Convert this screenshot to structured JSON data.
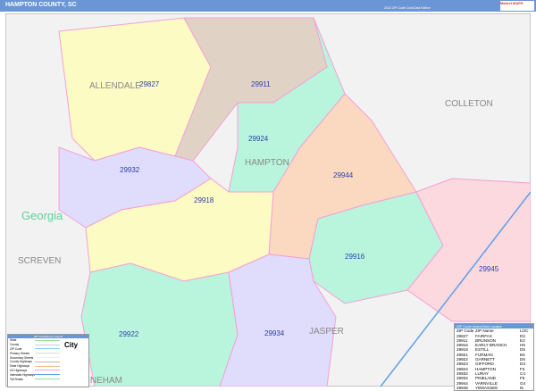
{
  "header": {
    "title": "HAMPTON COUNTY, SC",
    "edition": "2022 ZIP Code ColorCast Edition",
    "logo": "Market MAPS"
  },
  "areas": [
    "ALLENDALE",
    "COLLETON",
    "HAMPTON",
    "Georgia",
    "SCREVEN",
    "JASPER",
    "FINEHAM"
  ],
  "zips": [
    {
      "code": "29827",
      "color": "#fdfbc4"
    },
    {
      "code": "29911",
      "color": "#e0d3c5"
    },
    {
      "code": "29924",
      "color": "#b9f5dd"
    },
    {
      "code": "29944",
      "color": "#fbd9c1"
    },
    {
      "code": "29932",
      "color": "#e0dcfb"
    },
    {
      "code": "29918",
      "color": "#fdfbc4"
    },
    {
      "code": "29916",
      "color": "#b9f5dd"
    },
    {
      "code": "29945",
      "color": "#fcd8df"
    },
    {
      "code": "29922",
      "color": "#b9f5dd"
    },
    {
      "code": "29934",
      "color": "#e0dcfb"
    }
  ],
  "zip_table": {
    "title": "ZIP Code Index/Grid Locator",
    "headers": [
      "ZIP Code",
      "ZIP Name",
      "LOC"
    ],
    "rows": [
      [
        "29827",
        "FAIRFAX",
        "D2"
      ],
      [
        "29911",
        "BRUNSON",
        "E2"
      ],
      [
        "29916",
        "EARLY BRANCH",
        "H5"
      ],
      [
        "29918",
        "ESTILL",
        "D5"
      ],
      [
        "29921",
        "FURMAN",
        "E5"
      ],
      [
        "29922",
        "GARNETT",
        "D6"
      ],
      [
        "29923",
        "GIFFORD",
        "D3"
      ],
      [
        "29924",
        "HAMPTON",
        "F3"
      ],
      [
        "29932",
        "LURAY",
        "C4"
      ],
      [
        "29934",
        "PINELAND",
        "F6"
      ],
      [
        "29944",
        "VARNVILLE",
        "G4"
      ],
      [
        "29945",
        "YEMASSEE",
        "I5"
      ]
    ]
  },
  "legend": {
    "title": "ZIP Code/Street Legend",
    "items": [
      "State",
      "County",
      "ZIP Code",
      "Primary Streets",
      "Secondary Streets",
      "County Highways",
      "State Highways",
      "US Highways",
      "Interstate Highways",
      "Toll Roads"
    ],
    "colors": [
      "#8fd98f",
      "#cccccc",
      "#7fd0f0",
      "#dddddd",
      "#eeeeee",
      "#bbbbbb",
      "#f5c08a",
      "#e9a0e0",
      "#5da0e8",
      "#8ce08c"
    ],
    "city": "City"
  }
}
